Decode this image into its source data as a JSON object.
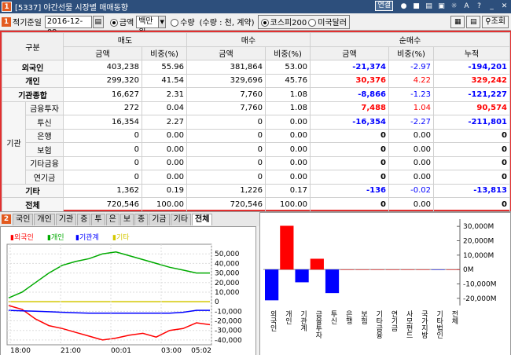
{
  "window": {
    "number": "1",
    "title": "[5337] 야간선물 시장별 매매동향",
    "link_tag": "연결",
    "help": "?"
  },
  "toolbar": {
    "section": "1",
    "date_label": "적기준일",
    "date_value": "2016-12-09",
    "amount_option": "금액",
    "unit_select": "백만원",
    "qty_option": "수량",
    "qty_note": "(수량 : 천, 계약)",
    "market1": "코스피200",
    "market2": "미국달러",
    "search_label": "조회"
  },
  "table": {
    "head1": {
      "group": "구분",
      "sell": "매도",
      "buy": "매수",
      "net": "순매수"
    },
    "head2": {
      "amt": "금액",
      "ratio": "비중(%)",
      "cum": "누적"
    },
    "inst_label": "기관",
    "rows": [
      {
        "name": "외국인",
        "sa": "403,238",
        "sr": "55.96",
        "ba": "381,864",
        "br": "53.00",
        "na": "-21,374",
        "nr": "-2.97",
        "nc": "-194,201",
        "cls": "blue"
      },
      {
        "name": "개인",
        "sa": "299,320",
        "sr": "41.54",
        "ba": "329,696",
        "br": "45.76",
        "na": "30,376",
        "nr": "4.22",
        "nc": "329,242",
        "cls": "red"
      },
      {
        "name": "기관종합",
        "sa": "16,627",
        "sr": "2.31",
        "ba": "7,760",
        "br": "1.08",
        "na": "-8,866",
        "nr": "-1.23",
        "nc": "-121,227",
        "cls": "blue"
      },
      {
        "name": "금융투자",
        "sa": "272",
        "sr": "0.04",
        "ba": "7,760",
        "br": "1.08",
        "na": "7,488",
        "nr": "1.04",
        "nc": "90,574",
        "cls": "red"
      },
      {
        "name": "투신",
        "sa": "16,354",
        "sr": "2.27",
        "ba": "0",
        "br": "0.00",
        "na": "-16,354",
        "nr": "-2.27",
        "nc": "-211,801",
        "cls": "blue"
      },
      {
        "name": "은행",
        "sa": "0",
        "sr": "0.00",
        "ba": "0",
        "br": "0.00",
        "na": "0",
        "nr": "0.00",
        "nc": "0",
        "cls": ""
      },
      {
        "name": "보험",
        "sa": "0",
        "sr": "0.00",
        "ba": "0",
        "br": "0.00",
        "na": "0",
        "nr": "0.00",
        "nc": "0",
        "cls": ""
      },
      {
        "name": "기타금융",
        "sa": "0",
        "sr": "0.00",
        "ba": "0",
        "br": "0.00",
        "na": "0",
        "nr": "0.00",
        "nc": "0",
        "cls": ""
      },
      {
        "name": "연기금",
        "sa": "0",
        "sr": "0.00",
        "ba": "0",
        "br": "0.00",
        "na": "0",
        "nr": "0.00",
        "nc": "0",
        "cls": ""
      },
      {
        "name": "기타",
        "sa": "1,362",
        "sr": "0.19",
        "ba": "1,226",
        "br": "0.17",
        "na": "-136",
        "nr": "-0.02",
        "nc": "-13,813",
        "cls": "blue"
      },
      {
        "name": "전체",
        "sa": "720,546",
        "sr": "100.00",
        "ba": "720,546",
        "br": "100.00",
        "na": "0",
        "nr": "0.00",
        "nc": "0",
        "cls": ""
      }
    ]
  },
  "tabs": {
    "section": "2",
    "items": [
      "국인",
      "개인",
      "기관",
      "증",
      "투",
      "은",
      "보",
      "종",
      "기금",
      "기타",
      "전체"
    ],
    "active_index": 10
  },
  "chart_data": [
    {
      "type": "line",
      "legend": [
        "외국인",
        "개인",
        "기관계",
        "기타"
      ],
      "colors": [
        "#ff0000",
        "#00aa00",
        "#0000ff",
        "#d4c800"
      ],
      "x_ticks": [
        "18:00",
        "21:00",
        "00:01",
        "03:00",
        "05:02"
      ],
      "y_ticks": [
        "50,000",
        "40,000",
        "30,000",
        "20,000",
        "10,000",
        "0",
        "-10,000",
        "-20,000",
        "-30,000",
        "-40,000"
      ],
      "ylim": [
        -45000,
        60000
      ],
      "series": [
        {
          "name": "외국인",
          "values": [
            -4000,
            -8000,
            -18000,
            -25000,
            -28000,
            -32000,
            -36000,
            -40000,
            -38000,
            -35000,
            -33000,
            -37000,
            -30000,
            -28000,
            -22000,
            -24000
          ]
        },
        {
          "name": "개인",
          "values": [
            4000,
            10000,
            20000,
            30000,
            38000,
            42000,
            45000,
            50000,
            52000,
            48000,
            44000,
            40000,
            36000,
            33000,
            30000,
            30000
          ]
        },
        {
          "name": "기관계",
          "values": [
            -9000,
            -9500,
            -10000,
            -10500,
            -11000,
            -11500,
            -12000,
            -12000,
            -12000,
            -12000,
            -12000,
            -12000,
            -12000,
            -11000,
            -9000,
            -9000
          ]
        },
        {
          "name": "기타",
          "values": [
            0,
            0,
            0,
            0,
            0,
            0,
            0,
            0,
            0,
            0,
            0,
            0,
            0,
            0,
            0,
            0
          ]
        }
      ]
    },
    {
      "type": "bar",
      "categories": [
        "외국인",
        "개인",
        "기관계",
        "금융투자",
        "투신",
        "은행",
        "보험",
        "기타금융",
        "연기금",
        "사모펀드",
        "국가지방",
        "기타법인",
        "전체"
      ],
      "values": [
        -21374,
        30376,
        -8866,
        7488,
        -16354,
        0,
        0,
        0,
        0,
        0,
        0,
        -136,
        0
      ],
      "y_ticks": [
        "30,000M",
        "20,000M",
        "10,000M",
        "0M",
        "-10,000M",
        "-20,000M"
      ],
      "ylim": [
        -25000,
        35000
      ],
      "colors": {
        "pos": "#ff0000",
        "neg": "#0000ff"
      }
    }
  ]
}
